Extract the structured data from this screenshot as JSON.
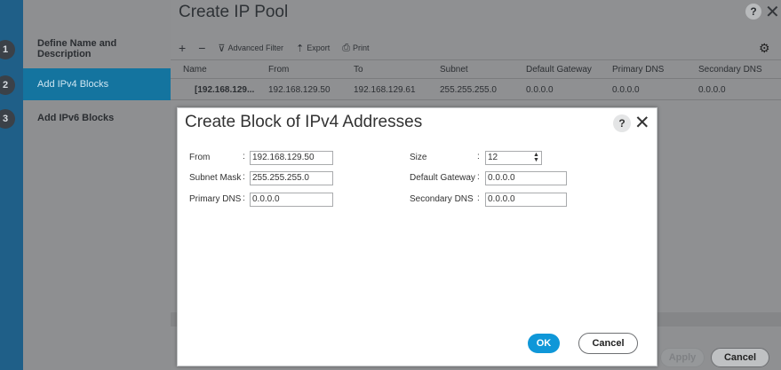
{
  "steps": [
    {
      "number": "1",
      "label": "Define Name and Description"
    },
    {
      "number": "2",
      "label": "Add IPv4 Blocks"
    },
    {
      "number": "3",
      "label": "Add IPv6 Blocks"
    }
  ],
  "window": {
    "title": "Create IP Pool",
    "help": "?",
    "close": "✕"
  },
  "toolbar": {
    "add": "+",
    "remove": "−",
    "advanced_filter": "Advanced Filter",
    "export": "Export",
    "print": "Print"
  },
  "table": {
    "columns": [
      "Name",
      "From",
      "To",
      "Subnet",
      "Default Gateway",
      "Primary DNS",
      "Secondary DNS"
    ],
    "rows": [
      [
        "[192.168.129...",
        "192.168.129.50",
        "192.168.129.61",
        "255.255.255.0",
        "0.0.0.0",
        "0.0.0.0",
        "0.0.0.0"
      ]
    ]
  },
  "footer": {
    "apply": "Apply",
    "cancel": "Cancel"
  },
  "modal": {
    "title": "Create Block of IPv4 Addresses",
    "help": "?",
    "close": "✕",
    "fields": {
      "from": {
        "label": "From",
        "value": "192.168.129.50"
      },
      "size": {
        "label": "Size",
        "value": "12"
      },
      "subnet_mask": {
        "label": "Subnet Mask",
        "value": "255.255.255.0"
      },
      "default_gateway": {
        "label": "Default Gateway",
        "value": "0.0.0.0"
      },
      "primary_dns": {
        "label": "Primary DNS",
        "value": "0.0.0.0"
      },
      "secondary_dns": {
        "label": "Secondary DNS",
        "value": "0.0.0.0"
      }
    },
    "ok": "OK",
    "cancel": "Cancel"
  },
  "colors": {
    "accent": "#0f97d8",
    "active_step": "#14749f",
    "overlay": "#8f9092"
  }
}
